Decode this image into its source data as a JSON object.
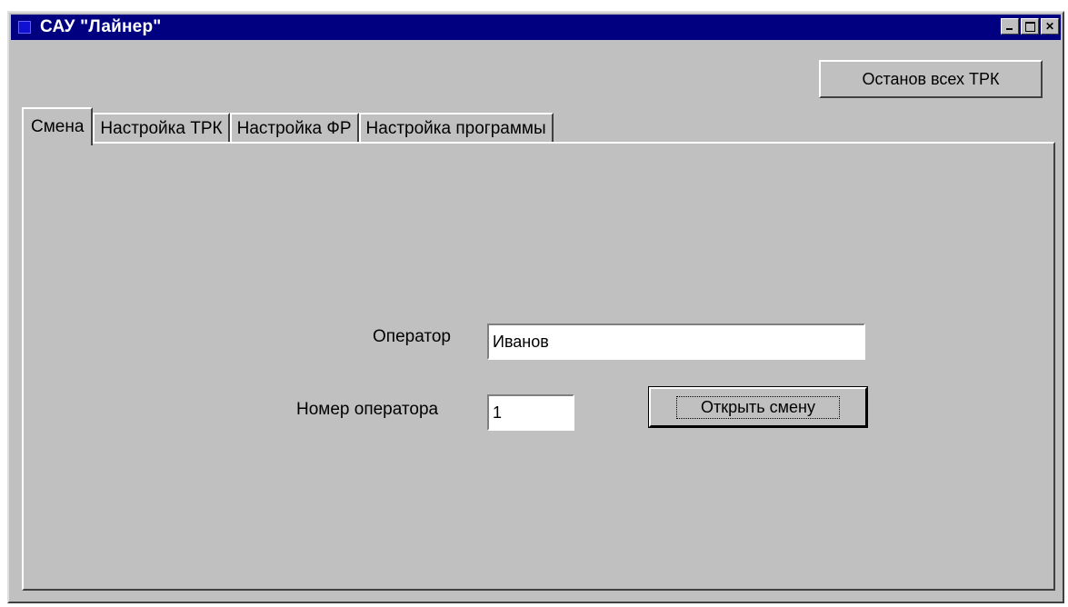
{
  "window": {
    "title": "САУ \"Лайнер\"",
    "icons": [
      "app-icon",
      "minimize-icon",
      "maximize-icon",
      "close-icon"
    ]
  },
  "toolbar": {
    "stop_all_label": "Останов всех ТРК"
  },
  "tabs": [
    {
      "label": "Смена",
      "active": true
    },
    {
      "label": "Настройка ТРК",
      "active": false
    },
    {
      "label": "Настройка ФР",
      "active": false
    },
    {
      "label": "Настройка программы",
      "active": false
    }
  ],
  "shift": {
    "operator_label": "Оператор",
    "operator_value": "Иванов",
    "operator_number_label": "Номер оператора",
    "operator_number_value": "1",
    "open_shift_label": "Открыть смену"
  },
  "colors": {
    "titlebar": "#000080",
    "face": "#c0c0c0"
  }
}
